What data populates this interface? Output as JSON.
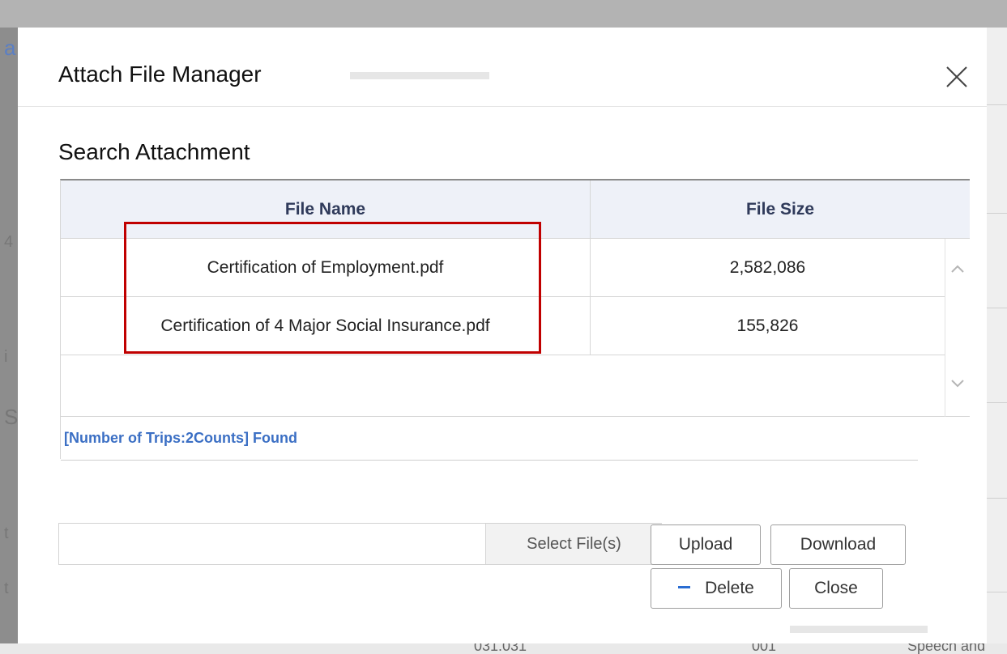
{
  "modal": {
    "title": "Attach File Manager",
    "close_icon": "close-icon"
  },
  "section": {
    "title": "Search Attachment"
  },
  "table": {
    "columns": [
      "File Name",
      "File Size"
    ],
    "rows": [
      {
        "name": "Certification of Employment.pdf",
        "size": "2,582,086"
      },
      {
        "name": "Certification of 4 Major Social Insurance.pdf",
        "size": "155,826"
      }
    ],
    "count_text": "[Number of Trips:2Counts] Found"
  },
  "controls": {
    "file_path_value": "",
    "select_file_label": "Select File(s)",
    "upload_label": "Upload",
    "download_label": "Download",
    "delete_label": "Delete",
    "close_label": "Close"
  },
  "colors": {
    "highlight": "#c00000",
    "count_text": "#3b6fc4",
    "delete_icon": "#2a6dd2",
    "header_bg": "#eef1f8"
  },
  "background": {
    "left_glyphs": [
      "a",
      "4",
      "i",
      "S",
      "t",
      "t"
    ],
    "bottom_texts": [
      "031.031",
      "001",
      "Speech and"
    ]
  }
}
